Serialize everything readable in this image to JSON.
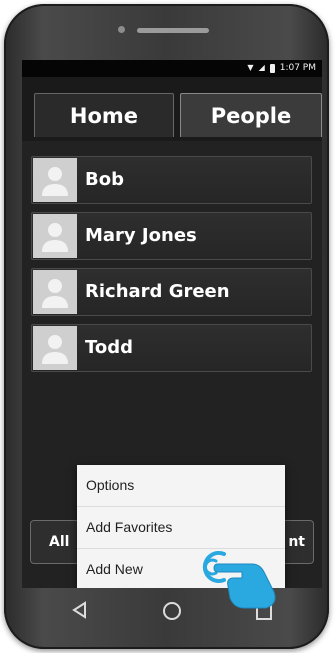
{
  "status_bar": {
    "time": "1:07 PM"
  },
  "tabs": [
    {
      "label": "Home",
      "active": false
    },
    {
      "label": "People",
      "active": true
    }
  ],
  "contacts": [
    {
      "name": "Bob"
    },
    {
      "name": "Mary Jones"
    },
    {
      "name": "Richard Green"
    },
    {
      "name": "Todd"
    }
  ],
  "bottom_buttons": {
    "left_label": "All",
    "right_label": "nt"
  },
  "menu": {
    "items": [
      {
        "label": "Options"
      },
      {
        "label": "Add Favorites"
      },
      {
        "label": "Add New"
      }
    ]
  },
  "nav_icons": [
    "back-triangle-icon",
    "home-circle-icon",
    "recents-square-icon"
  ],
  "colors": {
    "accent_touch": "#29a9e0",
    "menu_bg": "#f4f4f4",
    "screen_bg": "#222222"
  }
}
